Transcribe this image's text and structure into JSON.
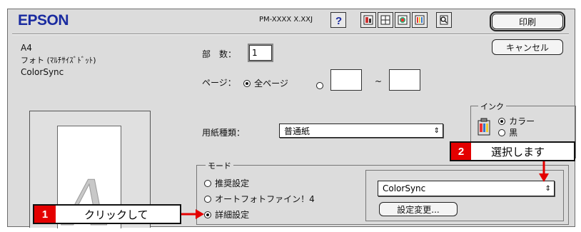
{
  "header": {
    "logo": "EPSON",
    "model": "PM-XXXX X.XXJ",
    "print_button": "印刷",
    "cancel_button": "キャンセル",
    "toolbar_icons": [
      "help-icon",
      "utility-icon-1",
      "utility-icon-2",
      "utility-icon-3",
      "utility-icon-4",
      "preview-icon"
    ]
  },
  "paper_info": {
    "size": "A4",
    "paper": "フォト (ﾏﾙﾁｻｲｽﾞﾄﾞｯﾄ)",
    "color": "ColorSync"
  },
  "copies": {
    "label": "部　数：",
    "value": "1"
  },
  "pages": {
    "label": "ページ：",
    "all_label": "全ページ",
    "all_selected": true,
    "from": "",
    "to": "",
    "separator": "~"
  },
  "media_type": {
    "label": "用紙種類：",
    "value": "普通紙"
  },
  "ink": {
    "title": "インク",
    "options": [
      {
        "label": "カラー",
        "selected": true
      },
      {
        "label": "黒",
        "selected": false
      }
    ]
  },
  "mode": {
    "title": "モード",
    "options": [
      {
        "label": "推奨設定",
        "selected": false
      },
      {
        "label": "オートフォトファイン！4",
        "selected": false
      },
      {
        "label": "詳細設定",
        "selected": true
      }
    ],
    "settings_select": "ColorSync",
    "change_button": "設定変更..."
  },
  "annotations": {
    "step1": {
      "number": "1",
      "text": "クリックして"
    },
    "step2": {
      "number": "2",
      "text": "選択します"
    },
    "arrow_color": "#e40000"
  }
}
